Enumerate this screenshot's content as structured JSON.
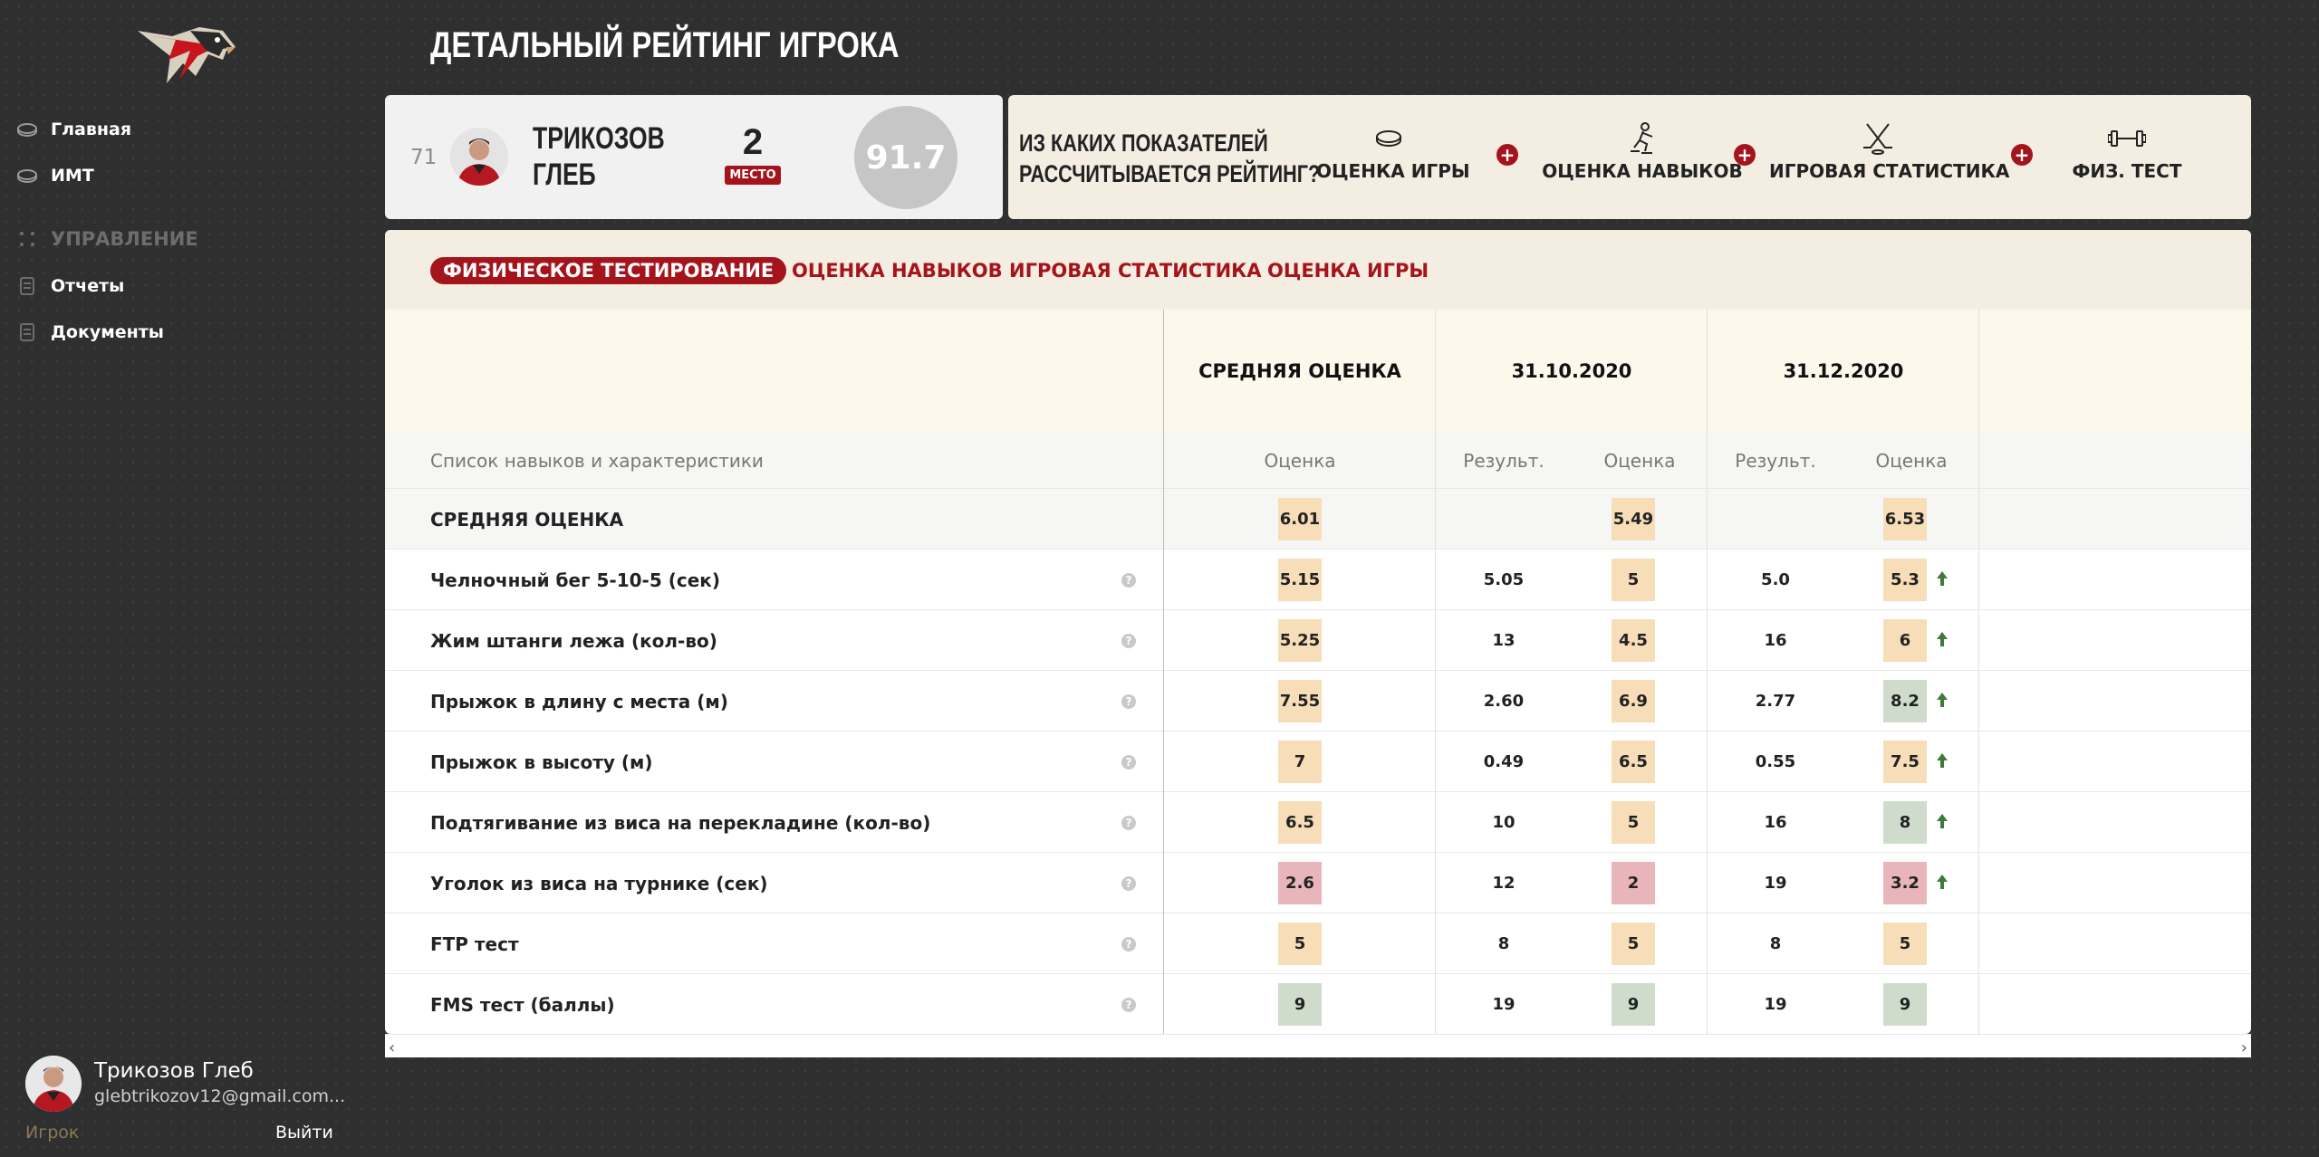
{
  "nav": {
    "items": [
      {
        "label": "Главная",
        "icon": "puck-icon"
      },
      {
        "label": "ИМТ",
        "icon": "puck-icon"
      }
    ],
    "section": "УПРАВЛЕНИЕ",
    "sub_items": [
      {
        "label": "Отчеты",
        "icon": "document-icon"
      },
      {
        "label": "Документы",
        "icon": "document-icon"
      }
    ]
  },
  "user": {
    "name": "Трикозов Глеб",
    "email": "glebtrikozov12@gmail.com...",
    "role": "Игрок",
    "logout": "Выйти"
  },
  "page_title": "ДЕТАЛЬНЫЙ РЕЙТИНГ ИГРОКА",
  "player": {
    "number": "71",
    "name_line1": "ТРИКОЗОВ",
    "name_line2": "ГЛЕБ",
    "place": "2",
    "place_label": "МЕСТО",
    "score": "91.7"
  },
  "formula": {
    "question_line1": "ИЗ КАКИХ ПОКАЗАТЕЛЕЙ",
    "question_line2": "РАССЧИТЫВАЕТСЯ РЕЙТИНГ?",
    "items": [
      {
        "label": "ОЦЕНКА ИГРЫ",
        "icon": "puck-icon"
      },
      {
        "label": "ОЦЕНКА НАВЫКОВ",
        "icon": "skater-icon"
      },
      {
        "label": "ИГРОВАЯ СТАТИСТИКА",
        "icon": "crossed-sticks-icon"
      },
      {
        "label": "ФИЗ. ТЕСТ",
        "icon": "dumbbell-icon"
      }
    ],
    "plus": "+"
  },
  "tabs": [
    "ФИЗИЧЕСКОЕ ТЕСТИРОВАНИЕ",
    "ОЦЕНКА НАВЫКОВ",
    "ИГРОВАЯ СТАТИСТИКА",
    "ОЦЕНКА ИГРЫ"
  ],
  "table": {
    "headers": {
      "avg": "СРЕДНЯЯ ОЦЕНКА",
      "date1": "31.10.2020",
      "date2": "31.12.2020"
    },
    "subheaders": {
      "list": "Список навыков и характеристики",
      "score": "Оценка",
      "result": "Результ."
    },
    "avg_row": {
      "label": "СРЕДНЯЯ ОЦЕНКА",
      "avg": "6.01",
      "d1": "5.49",
      "d2": "6.53"
    },
    "help": "?",
    "rows": [
      {
        "label": "Челночный бег 5-10-5 (сек)",
        "avg": "5.15",
        "r1": "5.05",
        "s1": "5",
        "r2": "5.0",
        "s2": "5.3",
        "up": true,
        "c_avg": "#f7ddb8",
        "c1": "#f7ddb8",
        "c2": "#f7ddb8"
      },
      {
        "label": "Жим штанги лежа (кол-во)",
        "avg": "5.25",
        "r1": "13",
        "s1": "4.5",
        "r2": "16",
        "s2": "6",
        "up": true,
        "c_avg": "#f7ddb8",
        "c1": "#f7ddb8",
        "c2": "#f7ddb8"
      },
      {
        "label": "Прыжок в длину с места (м)",
        "avg": "7.55",
        "r1": "2.60",
        "s1": "6.9",
        "r2": "2.77",
        "s2": "8.2",
        "up": true,
        "c_avg": "#f7ddb8",
        "c1": "#f7ddb8",
        "c2": "#cfdccb"
      },
      {
        "label": "Прыжок в высоту (м)",
        "avg": "7",
        "r1": "0.49",
        "s1": "6.5",
        "r2": "0.55",
        "s2": "7.5",
        "up": true,
        "c_avg": "#f7ddb8",
        "c1": "#f7ddb8",
        "c2": "#f7ddb8"
      },
      {
        "label": "Подтягивание из виса на перекладине (кол-во)",
        "avg": "6.5",
        "r1": "10",
        "s1": "5",
        "r2": "16",
        "s2": "8",
        "up": true,
        "c_avg": "#f7ddb8",
        "c1": "#f7ddb8",
        "c2": "#cfdccb"
      },
      {
        "label": "Уголок из виса на турнике (сек)",
        "avg": "2.6",
        "r1": "12",
        "s1": "2",
        "r2": "19",
        "s2": "3.2",
        "up": true,
        "c_avg": "#e8b5bb",
        "c1": "#e8b5bb",
        "c2": "#e8b5bb"
      },
      {
        "label": "FTP тест",
        "avg": "5",
        "r1": "8",
        "s1": "5",
        "r2": "8",
        "s2": "5",
        "up": false,
        "c_avg": "#f7ddb8",
        "c1": "#f7ddb8",
        "c2": "#f7ddb8"
      },
      {
        "label": "FMS тест (баллы)",
        "avg": "9",
        "r1": "19",
        "s1": "9",
        "r2": "19",
        "s2": "9",
        "up": false,
        "c_avg": "#cfdccb",
        "c1": "#cfdccb",
        "c2": "#cfdccb"
      }
    ]
  },
  "colors": {
    "accent": "#a5131b",
    "badge_avg": "#f7ddb8",
    "arrow": "#3f7a3a"
  }
}
